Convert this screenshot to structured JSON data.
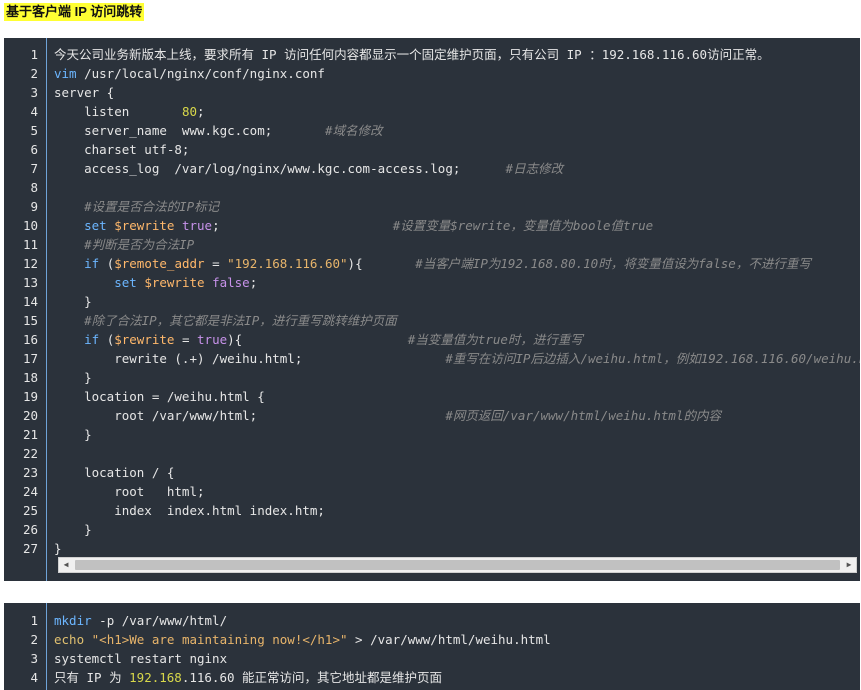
{
  "heading": "基于客户端 IP 访问跳转",
  "block1": {
    "lines": [
      {
        "n": "1",
        "segs": [
          {
            "t": "今天公司业务新版本上线，要求所有 IP 访问任何内容都显示一个固定维护页面，只有公司 IP ：192.168.116.60访问正常。",
            "c": ""
          }
        ]
      },
      {
        "n": "2",
        "segs": [
          {
            "t": "vim",
            "c": "kw"
          },
          {
            "t": " /usr/local/nginx/conf/nginx.conf",
            "c": ""
          }
        ]
      },
      {
        "n": "3",
        "segs": [
          {
            "t": "server {",
            "c": ""
          }
        ]
      },
      {
        "n": "4",
        "segs": [
          {
            "t": "    listen       ",
            "c": ""
          },
          {
            "t": "80",
            "c": "num"
          },
          {
            "t": ";",
            "c": ""
          }
        ]
      },
      {
        "n": "5",
        "segs": [
          {
            "t": "    server_name  www.kgc.com;       ",
            "c": ""
          },
          {
            "t": "#域名修改",
            "c": "cm"
          }
        ]
      },
      {
        "n": "6",
        "segs": [
          {
            "t": "    charset utf-8;",
            "c": ""
          }
        ]
      },
      {
        "n": "7",
        "segs": [
          {
            "t": "    access_log  /var/log/nginx/www.kgc.com-access.log;      ",
            "c": ""
          },
          {
            "t": "#日志修改",
            "c": "cm"
          }
        ]
      },
      {
        "n": "8",
        "segs": [
          {
            "t": "",
            "c": ""
          }
        ]
      },
      {
        "n": "9",
        "segs": [
          {
            "t": "    ",
            "c": ""
          },
          {
            "t": "#设置是否合法的IP标记",
            "c": "cm"
          }
        ]
      },
      {
        "n": "10",
        "segs": [
          {
            "t": "    ",
            "c": ""
          },
          {
            "t": "set",
            "c": "kw"
          },
          {
            "t": " ",
            "c": ""
          },
          {
            "t": "$rewrite",
            "c": "var"
          },
          {
            "t": " ",
            "c": ""
          },
          {
            "t": "true",
            "c": "bool"
          },
          {
            "t": ";                       ",
            "c": ""
          },
          {
            "t": "#设置变量$rewrite，变量值为boole值true",
            "c": "cm"
          }
        ]
      },
      {
        "n": "11",
        "segs": [
          {
            "t": "    ",
            "c": ""
          },
          {
            "t": "#判断是否为合法IP",
            "c": "cm"
          }
        ]
      },
      {
        "n": "12",
        "segs": [
          {
            "t": "    ",
            "c": ""
          },
          {
            "t": "if",
            "c": "kw"
          },
          {
            "t": " (",
            "c": ""
          },
          {
            "t": "$remote_addr",
            "c": "var"
          },
          {
            "t": " = ",
            "c": ""
          },
          {
            "t": "\"192.168.116.60\"",
            "c": "str"
          },
          {
            "t": "){       ",
            "c": ""
          },
          {
            "t": "#当客户端IP为192.168.80.10时，将变量值设为false，不进行重写",
            "c": "cm"
          }
        ]
      },
      {
        "n": "13",
        "segs": [
          {
            "t": "        ",
            "c": ""
          },
          {
            "t": "set",
            "c": "kw"
          },
          {
            "t": " ",
            "c": ""
          },
          {
            "t": "$rewrite",
            "c": "var"
          },
          {
            "t": " ",
            "c": ""
          },
          {
            "t": "false",
            "c": "bool"
          },
          {
            "t": ";",
            "c": ""
          }
        ]
      },
      {
        "n": "14",
        "segs": [
          {
            "t": "    }",
            "c": ""
          }
        ]
      },
      {
        "n": "15",
        "segs": [
          {
            "t": "    ",
            "c": ""
          },
          {
            "t": "#除了合法IP，其它都是非法IP，进行重写跳转维护页面",
            "c": "cm"
          }
        ]
      },
      {
        "n": "16",
        "segs": [
          {
            "t": "    ",
            "c": ""
          },
          {
            "t": "if",
            "c": "kw"
          },
          {
            "t": " (",
            "c": ""
          },
          {
            "t": "$rewrite",
            "c": "var"
          },
          {
            "t": " = ",
            "c": ""
          },
          {
            "t": "true",
            "c": "bool"
          },
          {
            "t": "){                      ",
            "c": ""
          },
          {
            "t": "#当变量值为true时，进行重写",
            "c": "cm"
          }
        ]
      },
      {
        "n": "17",
        "segs": [
          {
            "t": "        rewrite (.+) /weihu.html;                   ",
            "c": ""
          },
          {
            "t": "#重写在访问IP后边插入/weihu.html，例如192.168.116.60/weihu.htm",
            "c": "cm"
          }
        ]
      },
      {
        "n": "18",
        "segs": [
          {
            "t": "    }",
            "c": ""
          }
        ]
      },
      {
        "n": "19",
        "segs": [
          {
            "t": "    location = /weihu.html {",
            "c": ""
          }
        ]
      },
      {
        "n": "20",
        "segs": [
          {
            "t": "        root /var/www/html;                         ",
            "c": ""
          },
          {
            "t": "#网页返回/var/www/html/weihu.html的内容",
            "c": "cm"
          }
        ]
      },
      {
        "n": "21",
        "segs": [
          {
            "t": "    }",
            "c": ""
          }
        ]
      },
      {
        "n": "22",
        "segs": [
          {
            "t": "",
            "c": ""
          }
        ]
      },
      {
        "n": "23",
        "segs": [
          {
            "t": "    location / {",
            "c": ""
          }
        ]
      },
      {
        "n": "24",
        "segs": [
          {
            "t": "        root   html;",
            "c": ""
          }
        ]
      },
      {
        "n": "25",
        "segs": [
          {
            "t": "        index  index.html index.htm;",
            "c": ""
          }
        ]
      },
      {
        "n": "26",
        "segs": [
          {
            "t": "    }",
            "c": ""
          }
        ]
      },
      {
        "n": "27",
        "segs": [
          {
            "t": "}",
            "c": ""
          }
        ]
      }
    ],
    "scroll_left_icon": "◀",
    "scroll_right_icon": "▶"
  },
  "block2": {
    "lines": [
      {
        "n": "1",
        "segs": [
          {
            "t": "mkdir",
            "c": "kw"
          },
          {
            "t": " -p /var/www/html/",
            "c": ""
          }
        ]
      },
      {
        "n": "2",
        "segs": [
          {
            "t": "echo",
            "c": "ec"
          },
          {
            "t": " ",
            "c": ""
          },
          {
            "t": "\"<h1>We are maintaining now!</h1>\"",
            "c": "str"
          },
          {
            "t": " > /var/www/html/weihu.html",
            "c": ""
          }
        ]
      },
      {
        "n": "3",
        "segs": [
          {
            "t": "systemctl restart nginx",
            "c": ""
          }
        ]
      },
      {
        "n": "4",
        "segs": [
          {
            "t": "只有 IP 为 ",
            "c": ""
          },
          {
            "t": "192.168",
            "c": "num"
          },
          {
            "t": ".116.60 能正常访问，其它地址都是维护页面",
            "c": ""
          }
        ]
      }
    ]
  }
}
